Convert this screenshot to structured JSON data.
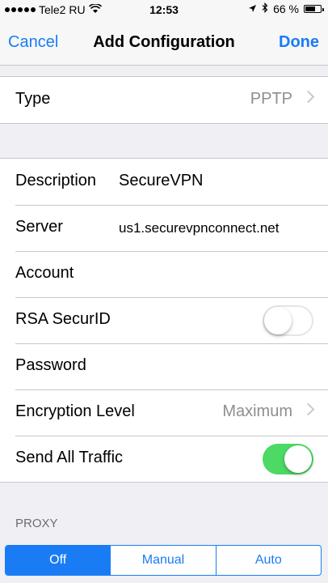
{
  "status": {
    "carrier": "Tele2 RU",
    "time": "12:53",
    "battery_text": "66 %",
    "battery_level": 0.66
  },
  "nav": {
    "cancel": "Cancel",
    "title": "Add Configuration",
    "done": "Done"
  },
  "type_row": {
    "label": "Type",
    "value": "PPTP"
  },
  "fields": {
    "description": {
      "label": "Description",
      "value": "SecureVPN"
    },
    "server": {
      "label": "Server",
      "value": "us1.securevpnconnect.net"
    },
    "account": {
      "label": "Account",
      "value": ""
    },
    "rsa": {
      "label": "RSA SecurID",
      "on": false
    },
    "password": {
      "label": "Password",
      "value": ""
    },
    "encryption": {
      "label": "Encryption Level",
      "value": "Maximum"
    },
    "send_all": {
      "label": "Send All Traffic",
      "on": true
    }
  },
  "proxy": {
    "header": "PROXY",
    "options": [
      "Off",
      "Manual",
      "Auto"
    ],
    "selected": "Off"
  },
  "colors": {
    "accent": "#1a7cf5",
    "toggle_on": "#4cd964",
    "background": "#efeff4"
  }
}
